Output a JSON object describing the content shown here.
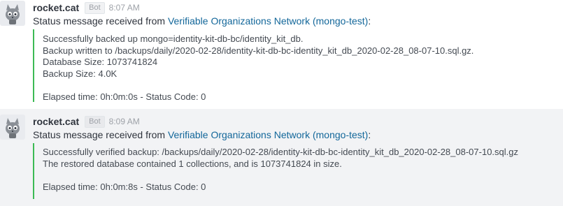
{
  "colors": {
    "attachment_border": "#3cba54",
    "link": "#13679a",
    "second_message_bg": "#f2f3f5"
  },
  "messages": [
    {
      "avatar_icon": "robot-cat-avatar-icon",
      "username": "rocket.cat",
      "badge": "Bot",
      "time": "8:07 AM",
      "intro_prefix": "Status message received from ",
      "intro_link": "Verifiable Organizations Network (mongo-test)",
      "intro_suffix": ":",
      "attachment_lines": [
        "Successfully backed up mongo=identity-kit-db-bc/identity_kit_db.",
        "Backup written to /backups/daily/2020-02-28/identity-kit-db-bc-identity_kit_db_2020-02-28_08-07-10.sql.gz.",
        "Database Size: 1073741824",
        "Backup Size: 4.0K",
        "",
        "Elapsed time: 0h:0m:0s - Status Code: 0"
      ]
    },
    {
      "avatar_icon": "robot-cat-avatar-icon",
      "username": "rocket.cat",
      "badge": "Bot",
      "time": "8:09 AM",
      "intro_prefix": "Status message received from ",
      "intro_link": "Verifiable Organizations Network (mongo-test)",
      "intro_suffix": ":",
      "attachment_lines": [
        "Successfully verified backup: /backups/daily/2020-02-28/identity-kit-db-bc-identity_kit_db_2020-02-28_08-07-10.sql.gz",
        "The restored database contained 1 collections, and is 1073741824 in size.",
        "",
        "Elapsed time: 0h:0m:8s - Status Code: 0"
      ]
    }
  ]
}
